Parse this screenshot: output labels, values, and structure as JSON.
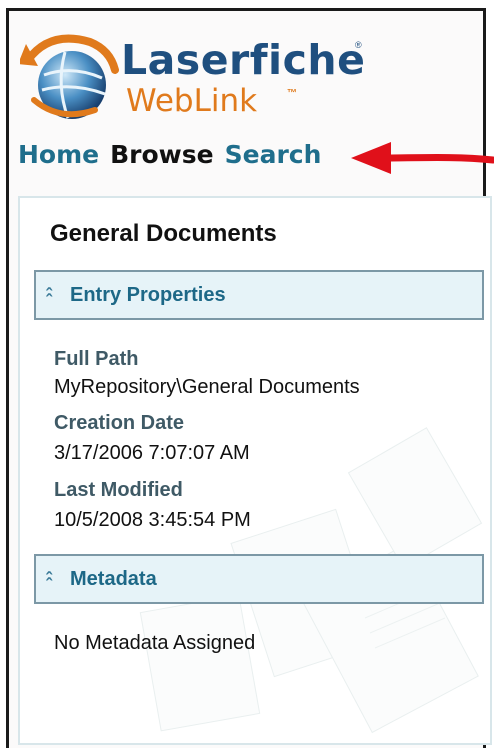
{
  "logo": {
    "name": "Laserfiche",
    "product": "WebLink",
    "reg": "®",
    "tm": "™"
  },
  "nav": {
    "home": "Home",
    "browse": "Browse",
    "search": "Search"
  },
  "panel": {
    "title": "General Documents",
    "entry_section": {
      "label": "Entry Properties",
      "properties": [
        {
          "label": "Full Path",
          "value": "MyRepository\\General Documents"
        },
        {
          "label": "Creation Date",
          "value": "3/17/2006 7:07:07 AM"
        },
        {
          "label": "Last Modified",
          "value": "10/5/2008 3:45:54 PM"
        }
      ]
    },
    "metadata_section": {
      "label": "Metadata",
      "empty_text": "No Metadata Assigned"
    }
  },
  "colors": {
    "link": "#1f6e8c",
    "annotation_arrow": "#e0101a",
    "section_bg": "#e6f3f8"
  },
  "icons": {
    "collapse": "double-chevron-up-icon",
    "logo": "globe-arrow-logo-icon",
    "annotation": "red-arrow-icon"
  }
}
